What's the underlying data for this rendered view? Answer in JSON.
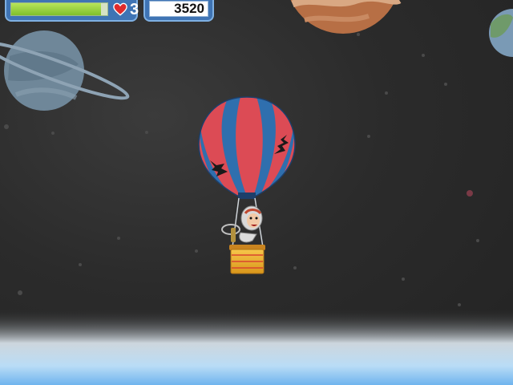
{
  "hud": {
    "health_level": 0.93,
    "lives": "3",
    "score": "3520"
  },
  "icons": {
    "lives": "heart-icon"
  },
  "colors": {
    "space": "#2b2b2b",
    "hud_panel": "#3f74b4",
    "health_fill": "#8ccf35",
    "heart": "#e02b2b",
    "balloon_red": "#dc4b55",
    "balloon_blue": "#2f6fae",
    "atmosphere": "#74b8f0"
  }
}
